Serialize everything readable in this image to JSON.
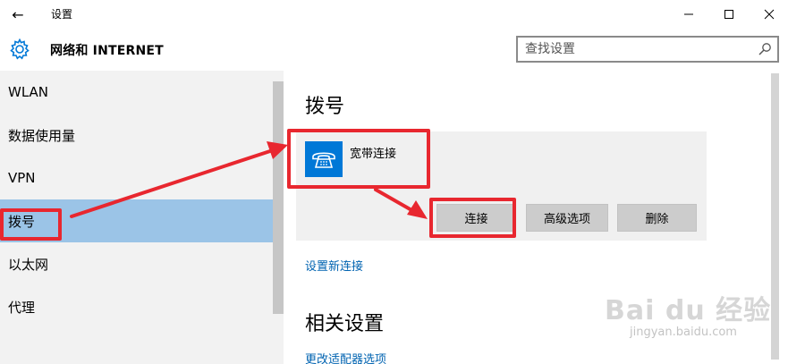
{
  "window": {
    "title": "设置",
    "back_glyph": "←",
    "minimize_glyph": "—",
    "close_glyph": "✕"
  },
  "header": {
    "section_title": "网络和 INTERNET",
    "search_placeholder": "查找设置"
  },
  "sidebar": {
    "items": [
      {
        "label": "WLAN"
      },
      {
        "label": "数据使用量"
      },
      {
        "label": "VPN"
      },
      {
        "label": "拨号",
        "selected": true
      },
      {
        "label": "以太网"
      },
      {
        "label": "代理"
      }
    ]
  },
  "content": {
    "heading": "拨号",
    "connection": {
      "name": "宽带连接",
      "buttons": {
        "connect": "连接",
        "advanced": "高级选项",
        "delete": "删除"
      }
    },
    "setup_link": "设置新连接",
    "related_heading": "相关设置",
    "adapter_link": "更改适配器选项"
  },
  "watermark": {
    "logo": "Bai du 经验",
    "url": "jingyan.baidu.com"
  },
  "colors": {
    "selected_nav": "#9bc4e7",
    "accent": "#0078d7",
    "link": "#0063b1",
    "annotation_red": "#e8272f"
  }
}
